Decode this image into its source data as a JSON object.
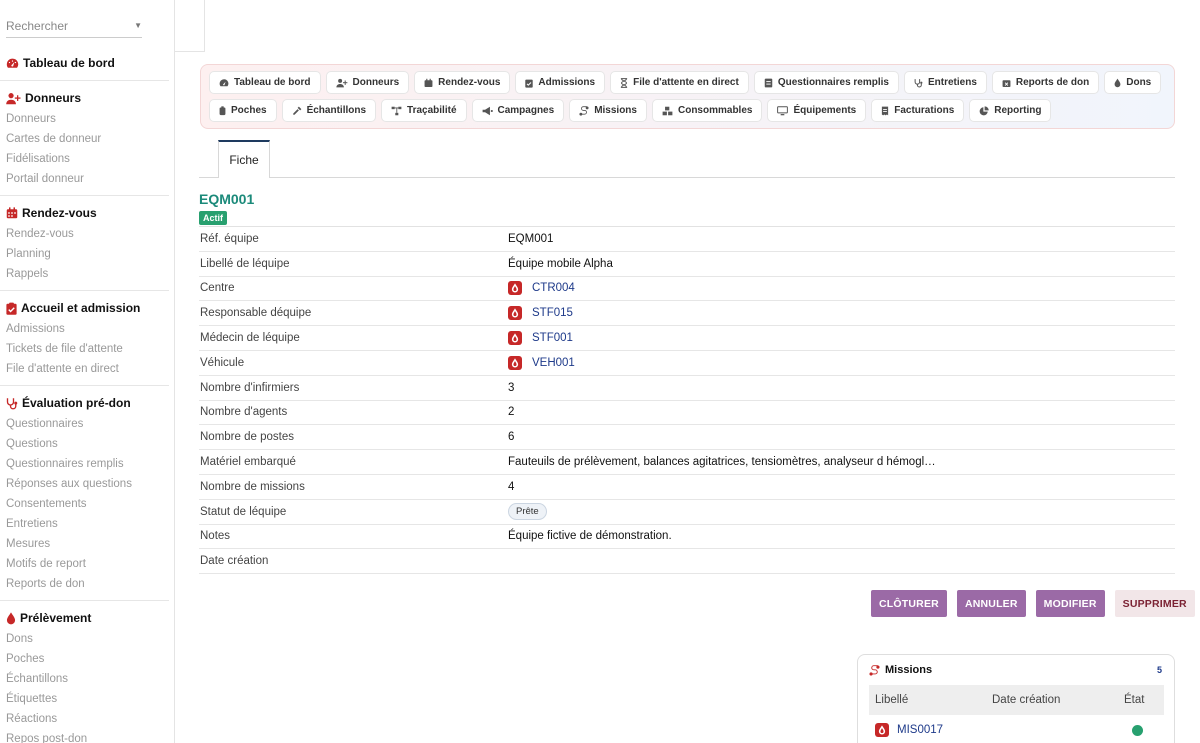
{
  "search": {
    "placeholder": "Rechercher"
  },
  "sidebar": {
    "sections": [
      {
        "title": "Tableau de bord",
        "items": []
      },
      {
        "title": "Donneurs",
        "items": [
          "Donneurs",
          "Cartes de donneur",
          "Fidélisations",
          "Portail donneur"
        ]
      },
      {
        "title": "Rendez-vous",
        "items": [
          "Rendez-vous",
          "Planning",
          "Rappels"
        ]
      },
      {
        "title": "Accueil et admission",
        "items": [
          "Admissions",
          "Tickets de file d'attente",
          "File d'attente en direct"
        ]
      },
      {
        "title": "Évaluation pré-don",
        "items": [
          "Questionnaires",
          "Questions",
          "Questionnaires remplis",
          "Réponses aux questions",
          "Consentements",
          "Entretiens",
          "Mesures",
          "Motifs de report",
          "Reports de don"
        ]
      },
      {
        "title": "Prélèvement",
        "items": [
          "Dons",
          "Poches",
          "Échantillons",
          "Étiquettes",
          "Réactions",
          "Repos post-don"
        ]
      }
    ]
  },
  "toolbar": {
    "buttons": [
      "Tableau de bord",
      "Donneurs",
      "Rendez-vous",
      "Admissions",
      "File d'attente en direct",
      "Questionnaires remplis",
      "Entretiens",
      "Reports de don",
      "Dons",
      "Poches",
      "Échantillons",
      "Traçabilité",
      "Campagnes",
      "Missions",
      "Consommables",
      "Équipements",
      "Facturations",
      "Reporting"
    ]
  },
  "tabs": {
    "fiche": "Fiche"
  },
  "record": {
    "title": "EQM001",
    "status": "Actif",
    "fields": [
      {
        "label": "Réf. équipe",
        "value": "EQM001"
      },
      {
        "label": "Libellé de léquipe",
        "value": "Équipe mobile Alpha"
      },
      {
        "label": "Centre",
        "value": "CTR004",
        "ref": true
      },
      {
        "label": "Responsable déquipe",
        "value": "STF015",
        "ref": true
      },
      {
        "label": "Médecin de léquipe",
        "value": "STF001",
        "ref": true
      },
      {
        "label": "Véhicule",
        "value": "VEH001",
        "ref": true
      },
      {
        "label": "Nombre d'infirmiers",
        "value": "3"
      },
      {
        "label": "Nombre d'agents",
        "value": "2"
      },
      {
        "label": "Nombre de postes",
        "value": "6"
      },
      {
        "label": "Matériel embarqué",
        "value": "Fauteuils de prélèvement, balances agitatrices, tensiomètres, analyseur d hémogl…"
      },
      {
        "label": "Nombre de missions",
        "value": "4"
      },
      {
        "label": "Statut de léquipe",
        "value": "Prête",
        "pill": true
      },
      {
        "label": "Notes",
        "value": "Équipe fictive de démonstration."
      },
      {
        "label": "Date création",
        "value": ""
      }
    ]
  },
  "actions": {
    "cloturer": "CLÔTURER",
    "annuler": "ANNULER",
    "modifier": "MODIFIER",
    "supprimer": "SUPPRIMER"
  },
  "missions_card": {
    "title": "Missions",
    "count": "5",
    "columns": [
      "Libellé",
      "Date création",
      "État"
    ],
    "rows": [
      {
        "label": "MIS0017",
        "date": "",
        "state_color": "#27a06f"
      }
    ]
  },
  "colors": {
    "accent": "#1b8a7a",
    "danger": "#c62828",
    "purple": "#9b6aa6",
    "link": "#1e3a8a"
  }
}
